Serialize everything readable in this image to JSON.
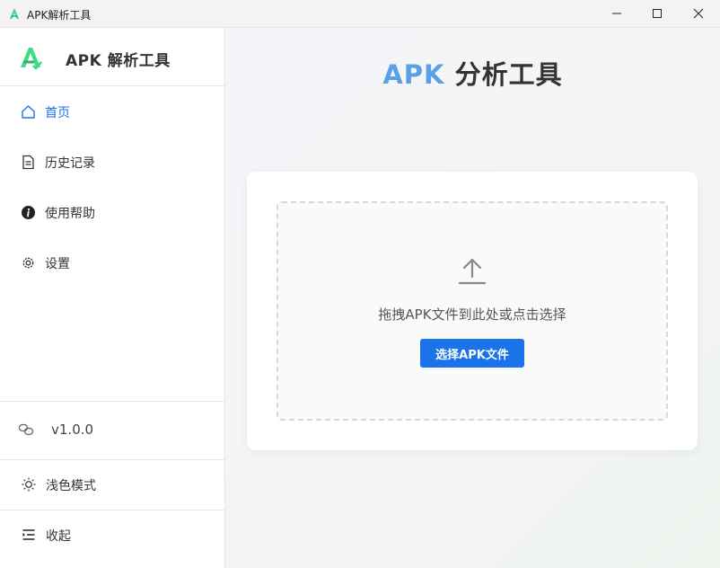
{
  "window": {
    "title": "APK解析工具",
    "controls": [
      "minimize-icon",
      "maximize-icon",
      "close-icon"
    ]
  },
  "sidebar": {
    "brand": {
      "name": "APK 解析工具",
      "logo_icon": "android-a-logo-icon"
    },
    "items": [
      {
        "label": "首页",
        "icon": "home-icon",
        "active": true
      },
      {
        "label": "历史记录",
        "icon": "document-icon",
        "active": false
      },
      {
        "label": "使用帮助",
        "icon": "info-icon",
        "active": false
      },
      {
        "label": "设置",
        "icon": "gear-icon",
        "active": false
      }
    ],
    "version": {
      "label": "v1.0.0",
      "icon": "link-chain-icon"
    },
    "theme": {
      "label": "浅色模式",
      "icon": "sun-icon"
    },
    "collapse": {
      "label": "收起",
      "icon": "menu-collapse-icon"
    }
  },
  "main": {
    "title_accent": "APK",
    "title_rest": "分析工具",
    "dropzone": {
      "icon": "upload-icon",
      "text": "拖拽APK文件到此处或点击选择",
      "button_label": "选择APK文件"
    }
  },
  "colors": {
    "accent": "#1a73e8",
    "title_accent": "#5a9fe8",
    "logo_green": "#3ddc84"
  }
}
